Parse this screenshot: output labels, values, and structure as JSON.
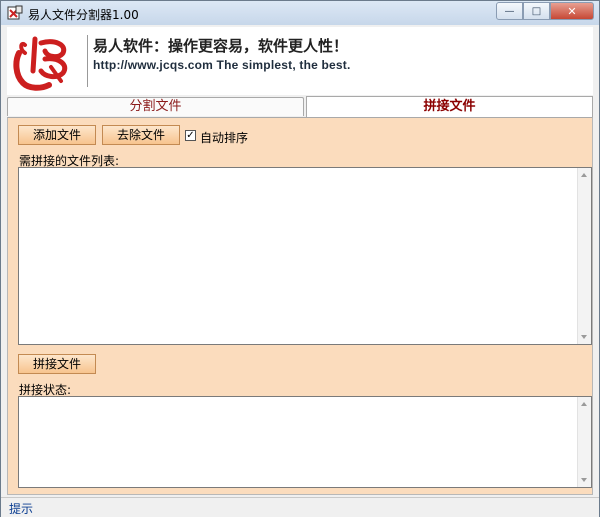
{
  "window": {
    "title": "易人文件分割器1.00",
    "minimize": "—",
    "maximize": "□",
    "close": "✕"
  },
  "banner": {
    "slogan": "易人软件：操作更容易，软件更人性！",
    "url": "http://www.jcqs.com  The simplest, the best."
  },
  "tabs": [
    {
      "label": "分割文件"
    },
    {
      "label": "拼接文件"
    }
  ],
  "join": {
    "add_button": "添加文件",
    "remove_button": "去除文件",
    "auto_sort_label": "自动排序",
    "auto_sort_checked": "✓",
    "list_label": "需拼接的文件列表:",
    "join_button": "拼接文件",
    "status_label": "拼接状态:"
  },
  "statusbar": {
    "text": "提示"
  },
  "colors": {
    "panel_bg": "#fbdcbd",
    "button_bg": "#f7c48e",
    "tab_text": "#8b0000",
    "logo_red": "#cc1f1f"
  }
}
